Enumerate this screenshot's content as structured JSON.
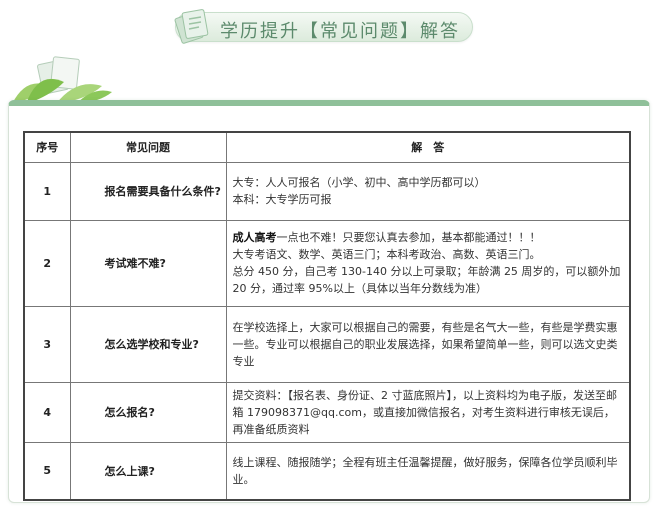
{
  "title": "学历提升【常见问题】解答",
  "table": {
    "headers": [
      "序号",
      "常见问题",
      "解　答"
    ],
    "rows": [
      {
        "num": "1",
        "question": "报名需要具备什么条件?",
        "answer_lines": [
          "大专：人人可报名（小学、初中、高中学历都可以）",
          "本科：大专学历可报"
        ]
      },
      {
        "num": "2",
        "question": "考试难不难?",
        "answer_bold": "成人高考",
        "answer_first_rest": "一点也不难！只要您认真去参加，基本都能通过！！！",
        "answer_lines": [
          "大专考语文、数学、英语三门；本科考政治、高数、英语三门。",
          "总分 450 分，自己考 130-140 分以上可录取；年龄满 25 周岁的，可以额外加 20 分，通过率 95%以上（具体以当年分数线为准）"
        ]
      },
      {
        "num": "3",
        "question": "怎么选学校和专业?",
        "answer_lines": [
          "在学校选择上，大家可以根据自己的需要，有些是名气大一些，有些是学费实惠一些。专业可以根据自己的职业发展选择，如果希望简单一些，则可以选文史类专业"
        ]
      },
      {
        "num": "4",
        "question": "怎么报名?",
        "answer_lines": [
          "提交资料：【报名表、身份证、2 寸蓝底照片】，以上资料均为电子版，发送至邮箱 179098371@qq.com，或直接加微信报名，对考生资料进行审核无误后，再准备纸质资料"
        ]
      },
      {
        "num": "5",
        "question": "怎么上课?",
        "answer_lines": [
          "线上课程、随报随学；全程有班主任温馨提醒，做好服务，保障各位学员顺利毕业。"
        ]
      }
    ]
  },
  "colors": {
    "accent": "#8fc099",
    "title_text": "#5c8a6c"
  },
  "icons": [
    "document-stack-icon",
    "leaf-decoration-icon"
  ]
}
